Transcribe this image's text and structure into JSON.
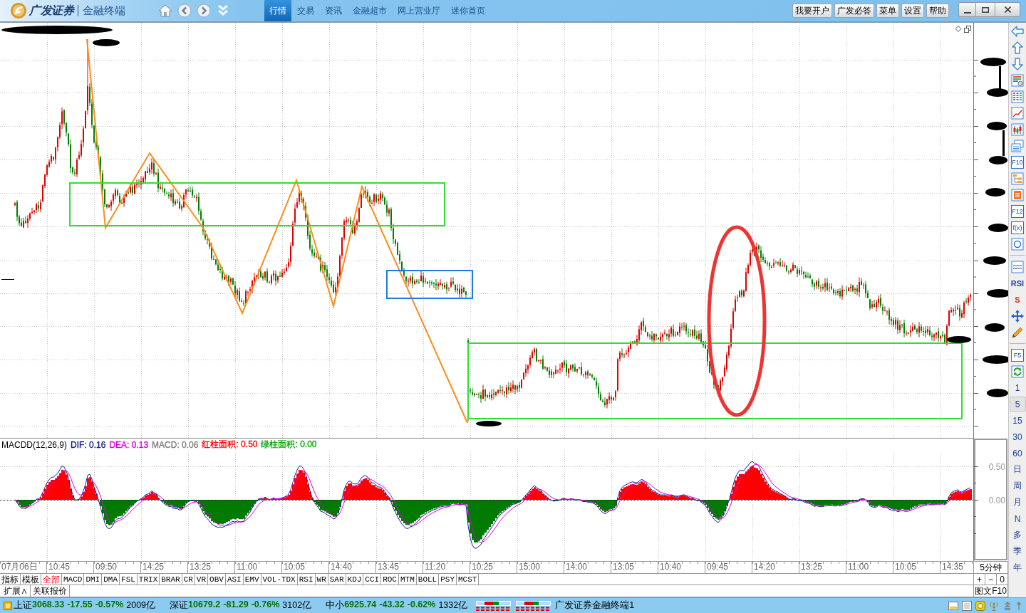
{
  "title_bar": {
    "brand": "广发证券",
    "product": "金融终端",
    "nav_tabs": [
      {
        "label": "行情",
        "selected": true
      },
      {
        "label": "交易",
        "selected": false
      },
      {
        "label": "资讯",
        "selected": false
      },
      {
        "label": "金融超市",
        "selected": false
      },
      {
        "label": "网上营业厅",
        "selected": false
      },
      {
        "label": "迷你首页",
        "selected": false
      }
    ],
    "buttons": [
      "我要开户",
      "广发必答",
      "菜单",
      "设置",
      "帮助"
    ]
  },
  "macd": {
    "title": "MACDD(12,26,9)",
    "readings": [
      {
        "text": "DIF: 0.16",
        "color": "#1c1c9c"
      },
      {
        "text": "DEA: 0.13",
        "color": "#e000e0"
      },
      {
        "text": "MACD: 0.06",
        "color": "#808080"
      },
      {
        "text": "红柱面积: 0.50",
        "color": "#ff0000"
      },
      {
        "text": "绿柱面积: 0.00",
        "color": "#00aa00"
      }
    ],
    "axis_labels": [
      "0.50",
      "0.00"
    ]
  },
  "time_axis": [
    "07月06日",
    "10:45",
    "09:50",
    "14:25",
    "13:25",
    "11:00",
    "10:05",
    "14:40",
    "13:45",
    "11:20",
    "10:25",
    "15:00",
    "14:00",
    "13:05",
    "10:40",
    "09:45",
    "14:20",
    "13:25",
    "11:00",
    "10:05",
    "14:35"
  ],
  "period_label": "5分钟",
  "zoom_controls": [
    "+",
    "−",
    "0"
  ],
  "f10_button": "图文F10",
  "indicator_tabs": [
    {
      "label": "指标",
      "selected": false
    },
    {
      "label": "模板",
      "selected": false
    },
    {
      "label": "全部",
      "selected": true
    },
    {
      "label": "MACD",
      "selected": false
    },
    {
      "label": "DMI",
      "selected": false
    },
    {
      "label": "DMA",
      "selected": false
    },
    {
      "label": "FSL",
      "selected": false
    },
    {
      "label": "TRIX",
      "selected": false
    },
    {
      "label": "BRAR",
      "selected": false
    },
    {
      "label": "CR",
      "selected": false
    },
    {
      "label": "VR",
      "selected": false
    },
    {
      "label": "OBV",
      "selected": false
    },
    {
      "label": "ASI",
      "selected": false
    },
    {
      "label": "EMV",
      "selected": false
    },
    {
      "label": "VOL-TDX",
      "selected": false
    },
    {
      "label": "RSI",
      "selected": false
    },
    {
      "label": "WR",
      "selected": false
    },
    {
      "label": "SAR",
      "selected": false
    },
    {
      "label": "KDJ",
      "selected": false
    },
    {
      "label": "CCI",
      "selected": false
    },
    {
      "label": "ROC",
      "selected": false
    },
    {
      "label": "MTM",
      "selected": false
    },
    {
      "label": "BOLL",
      "selected": false
    },
    {
      "label": "PSY",
      "selected": false
    },
    {
      "label": "MCST",
      "selected": false
    }
  ],
  "extra_tabs": [
    "扩展∧",
    "关联报价"
  ],
  "tools": [
    {
      "kind": "arrow_left"
    },
    {
      "kind": "arrow_up"
    },
    {
      "kind": "arrow_down"
    },
    {
      "kind": "report"
    },
    {
      "kind": "table"
    },
    {
      "kind": "trend"
    },
    {
      "kind": "candles"
    },
    {
      "kind": "windows"
    },
    {
      "kind": "boxed",
      "label": "F10"
    },
    {
      "kind": "tree"
    },
    {
      "kind": "note"
    },
    {
      "kind": "boxed",
      "label": "F12"
    },
    {
      "kind": "boxed",
      "label": "f(x)"
    },
    {
      "kind": "circle"
    },
    {
      "kind": "divider"
    },
    {
      "kind": "wave"
    },
    {
      "kind": "word",
      "label": "RSI",
      "color": "#2b3fb8"
    },
    {
      "kind": "word",
      "label": "S",
      "color": "#d0302a"
    },
    {
      "kind": "move"
    },
    {
      "kind": "pencil"
    },
    {
      "kind": "divider"
    },
    {
      "kind": "boxed",
      "label": "F5"
    },
    {
      "kind": "refresh"
    }
  ],
  "periods": [
    {
      "label": "1",
      "selected": false
    },
    {
      "label": "5",
      "selected": true
    },
    {
      "label": "15",
      "selected": false
    },
    {
      "label": "30",
      "selected": false
    },
    {
      "label": "60",
      "selected": false
    },
    {
      "label": "日",
      "selected": false
    },
    {
      "label": "周",
      "selected": false
    },
    {
      "label": "月",
      "selected": false
    },
    {
      "label": "N",
      "selected": false
    },
    {
      "label": "多",
      "selected": false
    },
    {
      "label": "季",
      "selected": false
    },
    {
      "label": "年",
      "selected": false
    }
  ],
  "status_bar": {
    "indices": [
      {
        "name": "上证",
        "value": "3068.33",
        "change": "-17.55",
        "percent": "-0.57%",
        "turnover": "2009亿"
      },
      {
        "name": "深证",
        "value": "10679.2",
        "change": "-81.29",
        "percent": "-0.76%",
        "turnover": "3102亿"
      },
      {
        "name": "中小",
        "value": "6925.74",
        "change": "-43.32",
        "percent": "-0.62%",
        "turnover": "1332亿"
      }
    ],
    "terminal": "广发证券金融终端1"
  }
}
